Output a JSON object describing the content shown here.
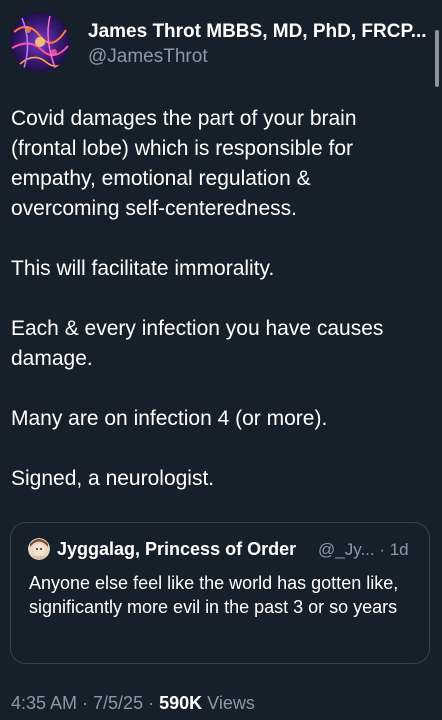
{
  "author": {
    "name": "James Throt MBBS, MD, PhD, FRCP...",
    "handle": "@JamesThrot"
  },
  "tweet": {
    "paragraphs": [
      "Covid damages the part of your brain (frontal lobe) which is responsible for empathy, emotional regulation & overcoming self-centeredness.",
      "This will facilitate immorality.",
      "Each & every infection you have causes damage.",
      "Many are on infection 4 (or more).",
      "Signed, a neurologist."
    ]
  },
  "quote": {
    "name": "Jyggalag, Princess of Order",
    "handle_time": "@_Jy... · 1d",
    "text": "Anyone else feel like the world has gotten like, significantly more evil in the past 3 or so years"
  },
  "meta": {
    "time_date": "4:35 AM · 7/5/25 ·",
    "views_count": "590K",
    "views_label": "Views"
  },
  "colors": {
    "background": "#15202b",
    "text_primary": "#ffffff",
    "text_secondary": "#8b98a5",
    "border": "#38444d"
  }
}
